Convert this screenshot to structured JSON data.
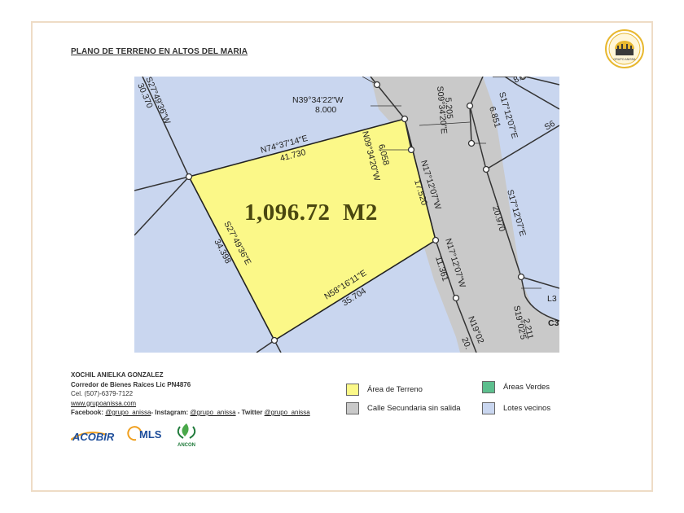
{
  "title": "PLANO DE TERRENO EN ALTOS DEL MARIA",
  "brand": {
    "logo_text": "GRUPO ANISSA",
    "color": "#e8b830"
  },
  "area_label": "1,096.72  M2",
  "map_labels": {
    "n39": "N39°34'22\"W",
    "n39_len": "8.000",
    "n74": "N74°37'14\"E",
    "n74_len": "41.730",
    "s27_top": "S27°49'36\"W",
    "s27_top_len": "30.370",
    "s27": "S27°49'36\"E",
    "s27_len": "34.398",
    "n58": "N58°16'11\"E",
    "n58_len": "35.704",
    "n09": "N09°34'20\"W",
    "n09_len": "6.058",
    "n17a": "N17°12'07\"W",
    "n17a_len": "17.520",
    "n17b": "N17°12'07\"W",
    "n17b_len": "11.361",
    "s09": "S09°34'20\"E",
    "s09_len": "5.205",
    "s17a": "S17°12'07\"E",
    "s17a_len": "6.851",
    "s17b": "S17°12'07\"E",
    "s17b_len": "20.970",
    "s19": "S19°02'5",
    "s19_len": "2.211",
    "n19": "N19°02",
    "n19_len": "20.",
    "c3": "C3",
    "l3": "L3",
    "top_frag": "8.0",
    "right_frag": "S6"
  },
  "contact": {
    "name": "XOCHIL ANIELKA GONZALEZ",
    "role": "Corredor de Bienes Raíces Lic PN4876",
    "phone": "Cel. (507)-6379-7122",
    "website": "www.grupoanissa.com",
    "social_prefix": "Facebook: ",
    "facebook": "@grupo_anissa",
    "instagram_prefix": "- Instagram: ",
    "instagram": "@grupo_anissa",
    "twitter_prefix": " - Twitter ",
    "twitter": "@grupo_anissa"
  },
  "legend": [
    {
      "label": "Área de Terreno",
      "color": "#fbf888"
    },
    {
      "label": "Áreas Verdes",
      "color": "#5dbf8e"
    },
    {
      "label": "Calle Secundaria sin salida",
      "color": "#c9c9c9"
    },
    {
      "label": "Lotes vecinos",
      "color": "#c9d6ef"
    }
  ],
  "logos": {
    "acobir": "ACOBIR",
    "mls": "MLS",
    "ancon": "ANCON"
  },
  "colors": {
    "lot": "#fbf888",
    "neighbors": "#c9d6ef",
    "street": "#c9c9c9",
    "green": "#5dbf8e"
  }
}
